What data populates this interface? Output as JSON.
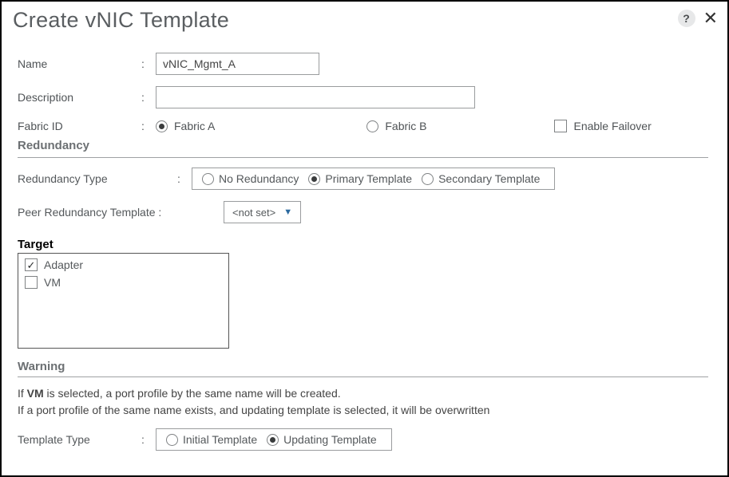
{
  "title": "Create vNIC Template",
  "help_icon": "?",
  "fields": {
    "name_label": "Name",
    "name_value": "vNIC_Mgmt_A",
    "desc_label": "Description",
    "desc_value": "",
    "fabric_label": "Fabric ID",
    "fabric_a": "Fabric A",
    "fabric_b": "Fabric B",
    "enable_failover": "Enable Failover"
  },
  "redundancy": {
    "heading": "Redundancy",
    "type_label": "Redundancy Type",
    "opt_none": "No Redundancy",
    "opt_primary": "Primary Template",
    "opt_secondary": "Secondary Template",
    "peer_label": "Peer Redundancy Template :",
    "peer_value": "<not set>"
  },
  "target": {
    "heading": "Target",
    "items": [
      {
        "label": "Adapter",
        "checked": true
      },
      {
        "label": "VM",
        "checked": false
      }
    ]
  },
  "warning": {
    "heading": "Warning",
    "line1a": "If ",
    "line1b": "VM",
    "line1c": " is selected, a port profile by the same name will be created.",
    "line2": "If a port profile of the same name exists, and updating template is selected, it will be overwritten"
  },
  "template_type": {
    "label": "Template Type",
    "opt_initial": "Initial Template",
    "opt_updating": "Updating Template"
  }
}
